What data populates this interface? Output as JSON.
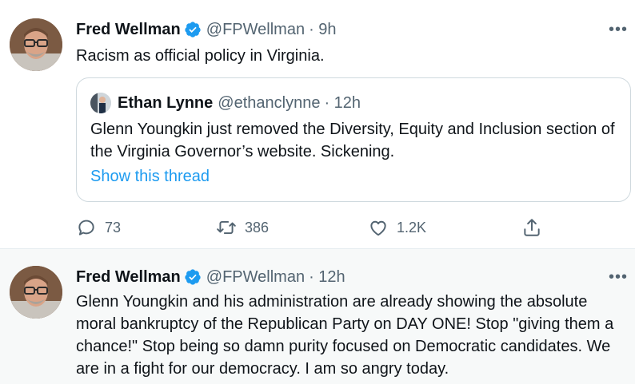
{
  "tweets": [
    {
      "author_name": "Fred Wellman",
      "handle": "@FPWellman",
      "time": "· 9h",
      "more": "•••",
      "text": "Racism as official policy in Virginia.",
      "quoted": {
        "author_name": "Ethan Lynne",
        "handle": "@ethanclynne",
        "time": "· 12h",
        "text": "Glenn Youngkin just removed the Diversity, Equity and Inclusion section of the Virginia Governor’s website. Sickening.",
        "thread_link": "Show this thread"
      },
      "actions": {
        "replies": "73",
        "retweets": "386",
        "likes": "1.2K"
      }
    },
    {
      "author_name": "Fred Wellman",
      "handle": "@FPWellman",
      "time": "· 12h",
      "more": "•••",
      "text": "Glenn Youngkin and his administration are already showing the absolute moral bankruptcy of the Republican Party on DAY ONE! Stop \"giving them a chance!\" Stop being so damn purity focused on Democratic candidates. We are in a fight for our democracy. I am so angry today."
    }
  ],
  "colors": {
    "link_blue": "#1d9bf0",
    "muted_gray": "#536471",
    "verified_blue": "#1d9bf0"
  },
  "icons": {
    "reply": "reply-icon",
    "retweet": "retweet-icon",
    "like": "heart-icon",
    "share": "share-icon",
    "verified": "verified-badge-icon",
    "more": "more-options-icon"
  }
}
